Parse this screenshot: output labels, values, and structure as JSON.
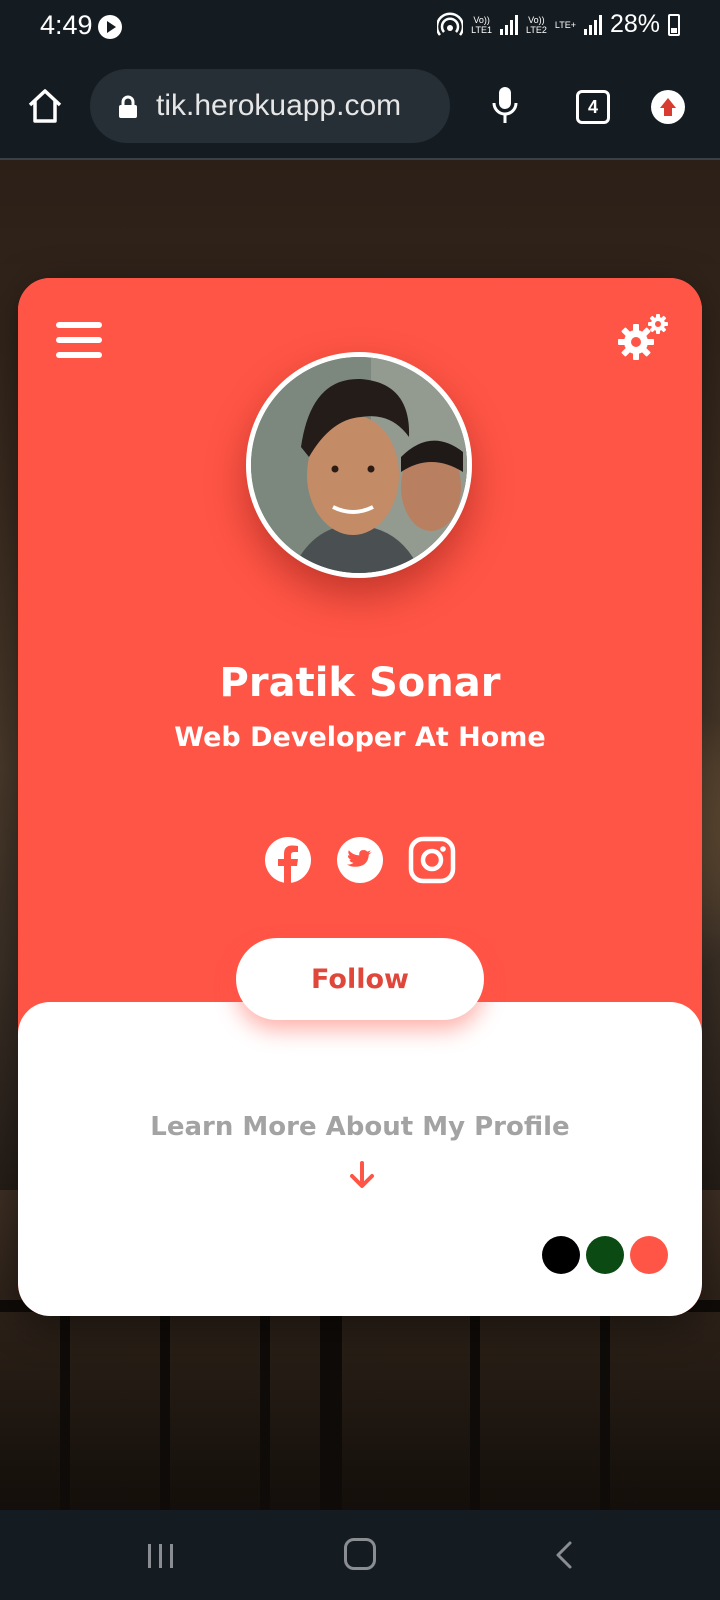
{
  "status_bar": {
    "time": "4:49",
    "sim1": "Vo))\nLTE1",
    "sim2": "Vo))\nLTE2",
    "sim2_extra": "LTE+",
    "battery": "28%"
  },
  "browser": {
    "url": "tik.herokuapp.com",
    "tab_count": "4"
  },
  "profile": {
    "name": "Pratik Sonar",
    "title": "Web Developer At Home",
    "follow_label": "Follow",
    "learn_more": "Learn More About My Profile",
    "socials": [
      "facebook-icon",
      "twitter-icon",
      "instagram-icon"
    ]
  },
  "theme_colors": {
    "accent": "#ff5546",
    "options": [
      "#000000",
      "#0b4a12",
      "#ff5546"
    ]
  }
}
